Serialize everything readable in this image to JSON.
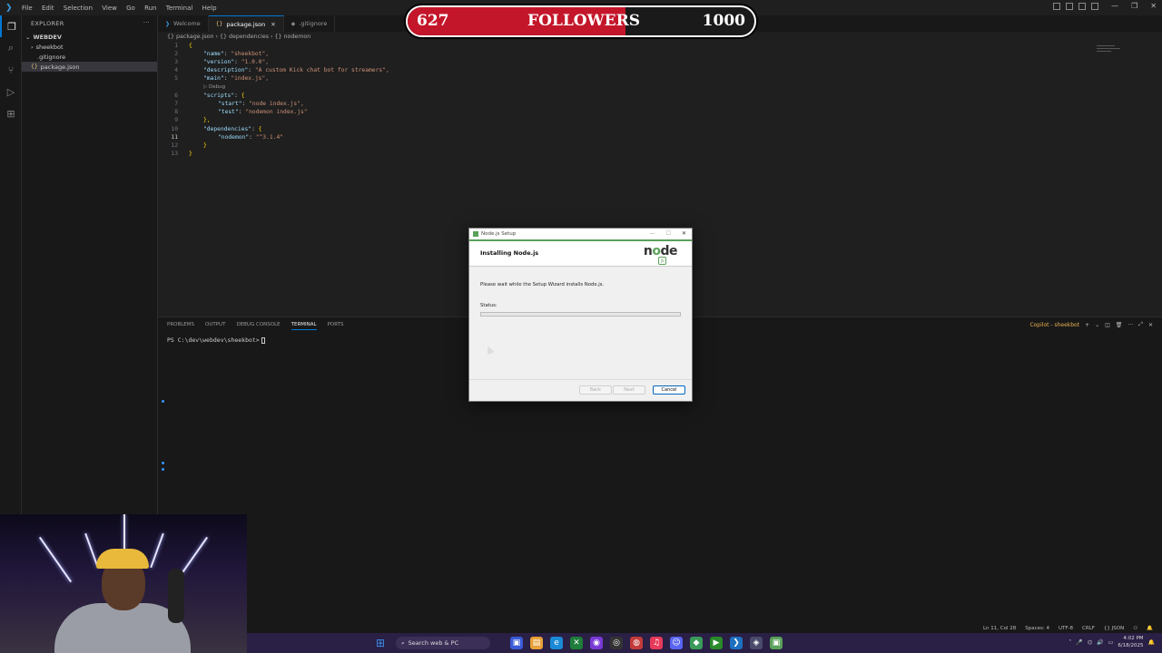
{
  "window": {
    "menu": [
      "File",
      "Edit",
      "Selection",
      "View",
      "Go",
      "Run",
      "Terminal",
      "Help"
    ]
  },
  "sidebar": {
    "title": "EXPLORER",
    "root": "WEBDEV",
    "items": [
      {
        "label": "sheekbot",
        "type": "folder"
      },
      {
        "label": ".gitignore",
        "type": "file"
      },
      {
        "label": "package.json",
        "type": "file",
        "selected": true
      }
    ]
  },
  "tabs": [
    {
      "label": "Welcome",
      "icon": "vscode-icon"
    },
    {
      "label": "package.json",
      "icon": "json-icon",
      "active": true
    },
    {
      "label": ".gitignore",
      "icon": "git-icon"
    }
  ],
  "breadcrumb": [
    "{} package.json",
    "{} dependencies",
    "{} nodemon"
  ],
  "editor": {
    "line_numbers": [
      "1",
      "2",
      "3",
      "4",
      "5",
      "6",
      "7",
      "8",
      "9",
      "10",
      "11",
      "12",
      "13"
    ],
    "codelens": "▷ Debug",
    "lines": [
      {
        "key": "",
        "val": "{"
      },
      {
        "key": "\"name\"",
        "val": "\"sheekbot\","
      },
      {
        "key": "\"version\"",
        "val": "\"1.0.0\","
      },
      {
        "key": "\"description\"",
        "val": "\"A custom Kick chat bot for streamers\","
      },
      {
        "key": "\"main\"",
        "val": "\"index.js\","
      },
      {
        "key": "\"scripts\"",
        "val": "{"
      },
      {
        "key": "\"start\"",
        "val": "\"node index.js\","
      },
      {
        "key": "\"test\"",
        "val": "\"nodemon index.js\""
      },
      {
        "key": "",
        "val": "},"
      },
      {
        "key": "\"dependencies\"",
        "val": "{"
      },
      {
        "key": "\"nodemon\"",
        "val": "\"^3.1.4\""
      },
      {
        "key": "",
        "val": "}"
      },
      {
        "key": "",
        "val": "}"
      }
    ]
  },
  "panel": {
    "tabs": [
      "PROBLEMS",
      "OUTPUT",
      "DEBUG CONSOLE",
      "TERMINAL",
      "PORTS"
    ],
    "active_tab": "TERMINAL",
    "prompt": "PS C:\\dev\\webdev\\sheekbot>",
    "terminal_label": "Copilot - sheekbot"
  },
  "statusbar": {
    "items": [
      "Ln 11, Col 28",
      "Spaces: 4",
      "UTF-8",
      "CRLF",
      "{} JSON"
    ]
  },
  "followers": {
    "current": "627",
    "label": "FOLLOWERS",
    "goal": "1000",
    "progress_fraction": 0.627,
    "fill_color": "#c4162a"
  },
  "dialog": {
    "title": "Node.js Setup",
    "heading": "Installing Node.js",
    "message": "Please wait while the Setup Wizard installs Node.js.",
    "status_label": "Status:",
    "progress_fraction": 0.0,
    "buttons": {
      "back": "Back",
      "next": "Next",
      "cancel": "Cancel"
    }
  },
  "taskbar": {
    "search_placeholder": "Search web & PC",
    "time": "4:02 PM",
    "date": "6/18/2025"
  },
  "colors": {
    "accent": "#0078d4",
    "node_green": "#5aa15a",
    "taskbar": "#2a1f45"
  }
}
